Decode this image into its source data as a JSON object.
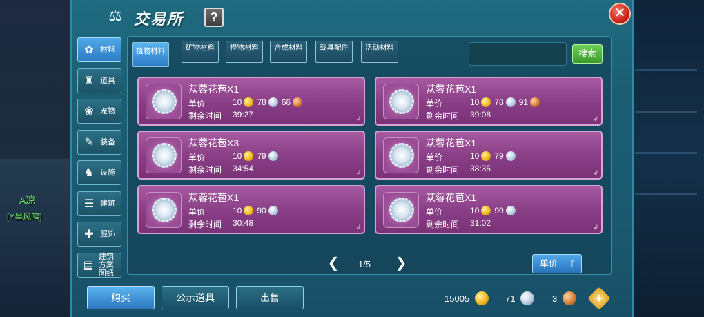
{
  "player": {
    "name": "A凉",
    "guild": "[Y墨风鸣]"
  },
  "header": {
    "title": "交易所",
    "help_label": "?",
    "close_label": "✕",
    "title_icon": "scale-icon"
  },
  "sidebar": {
    "items": [
      {
        "label": "材料",
        "icon": "materials-icon",
        "glyph": "✿",
        "active": true
      },
      {
        "label": "道具",
        "icon": "flask-icon",
        "glyph": "♜",
        "active": false
      },
      {
        "label": "宠物",
        "icon": "paw-icon",
        "glyph": "❀",
        "active": false
      },
      {
        "label": "装备",
        "icon": "sword-icon",
        "glyph": "✎",
        "active": false
      },
      {
        "label": "设施",
        "icon": "horse-icon",
        "glyph": "♞",
        "active": false
      },
      {
        "label": "建筑",
        "icon": "building-icon",
        "glyph": "☰",
        "active": false
      },
      {
        "label": "服饰",
        "icon": "clothing-icon",
        "glyph": "✚",
        "active": false
      },
      {
        "label": "建筑方案图纸",
        "icon": "blueprint-icon",
        "glyph": "▤",
        "active": false
      }
    ]
  },
  "tabs": [
    {
      "label": "植物材料",
      "active": true
    },
    {
      "label": "矿物材料",
      "active": false
    },
    {
      "label": "怪物材料",
      "active": false
    },
    {
      "label": "合成材料",
      "active": false
    },
    {
      "label": "载具配件",
      "active": false
    },
    {
      "label": "活动材料",
      "active": false
    }
  ],
  "search": {
    "placeholder": "",
    "button_label": "搜索"
  },
  "labels": {
    "price": "单价",
    "time_left": "剩余时间"
  },
  "listings": [
    {
      "name": "苁蓉花苞X1",
      "price": {
        "gold": "10",
        "silver": "78",
        "copper": "66"
      },
      "time_left": "39:27"
    },
    {
      "name": "苁蓉花苞X1",
      "price": {
        "gold": "10",
        "silver": "78",
        "copper": "91"
      },
      "time_left": "39:08"
    },
    {
      "name": "苁蓉花苞X3",
      "price": {
        "gold": "10",
        "silver": "79",
        "copper": ""
      },
      "time_left": "34:54"
    },
    {
      "name": "苁蓉花苞X1",
      "price": {
        "gold": "10",
        "silver": "79",
        "copper": ""
      },
      "time_left": "38:35"
    },
    {
      "name": "苁蓉花苞X1",
      "price": {
        "gold": "10",
        "silver": "90",
        "copper": ""
      },
      "time_left": "30:48"
    },
    {
      "name": "苁蓉花苞X1",
      "price": {
        "gold": "10",
        "silver": "90",
        "copper": ""
      },
      "time_left": "31:02"
    }
  ],
  "pagination": {
    "current": "1/5"
  },
  "sort": {
    "label": "单价"
  },
  "bottom": {
    "buy_label": "购买",
    "public_label": "公示道具",
    "sell_label": "出售",
    "currency": {
      "gold": "15005",
      "silver": "71",
      "copper": "3"
    }
  }
}
